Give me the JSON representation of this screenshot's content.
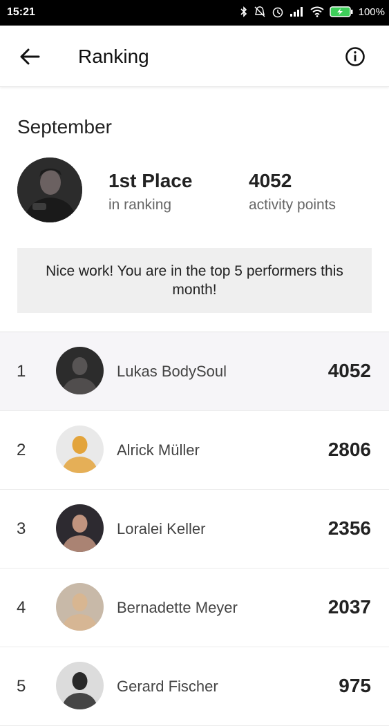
{
  "status_bar": {
    "time": "15:21",
    "battery": "100%"
  },
  "header": {
    "title": "Ranking"
  },
  "summary": {
    "month": "September",
    "place": "1st Place",
    "place_label": "in ranking",
    "points": "4052",
    "points_label": "activity points",
    "message": "Nice work! You are in the top 5 performers this month!"
  },
  "ranking": [
    {
      "rank": "1",
      "name": "Lukas BodySoul",
      "points": "4052",
      "highlighted": true,
      "avatar_bg": "#2c2c2c",
      "avatar_fg": "#5a5656"
    },
    {
      "rank": "2",
      "name": "Alrick Müller",
      "points": "2806",
      "highlighted": false,
      "avatar_bg": "#e9e9e9",
      "avatar_fg": "#e3a032"
    },
    {
      "rank": "3",
      "name": "Loralei Keller",
      "points": "2356",
      "highlighted": false,
      "avatar_bg": "#2d2a30",
      "avatar_fg": "#c99a84"
    },
    {
      "rank": "4",
      "name": "Bernadette Meyer",
      "points": "2037",
      "highlighted": false,
      "avatar_bg": "#c8b9a8",
      "avatar_fg": "#d9b58f"
    },
    {
      "rank": "5",
      "name": "Gerard Fischer",
      "points": "975",
      "highlighted": false,
      "avatar_bg": "#dcdcdc",
      "avatar_fg": "#1f1f1f"
    }
  ]
}
